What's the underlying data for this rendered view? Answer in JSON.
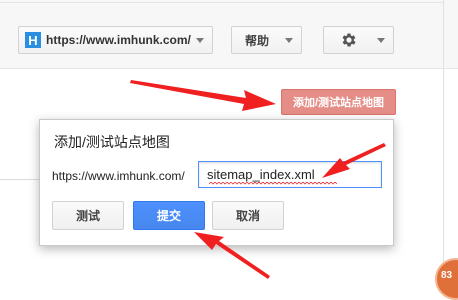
{
  "toolbar": {
    "site_icon_letter": "H",
    "site_url": "https://www.imhunk.com/",
    "help_label": "帮助"
  },
  "sitemap_button_label": "添加/测试站点地图",
  "dialog": {
    "title": "添加/测试站点地图",
    "url_prefix": "https://www.imhunk.com/",
    "input_value": "sitemap_index.xml",
    "test_label": "测试",
    "submit_label": "提交",
    "cancel_label": "取消"
  },
  "badge": {
    "text": "83"
  },
  "colors": {
    "submit_blue": "#4d90fe",
    "sitemap_button": "#e58e88",
    "annotation_arrow": "#f02020",
    "badge_orange": "#e0703a"
  },
  "icons": [
    "site-favicon-icon",
    "chevron-down-icon",
    "gear-icon",
    "red-arrow-annotation"
  ]
}
